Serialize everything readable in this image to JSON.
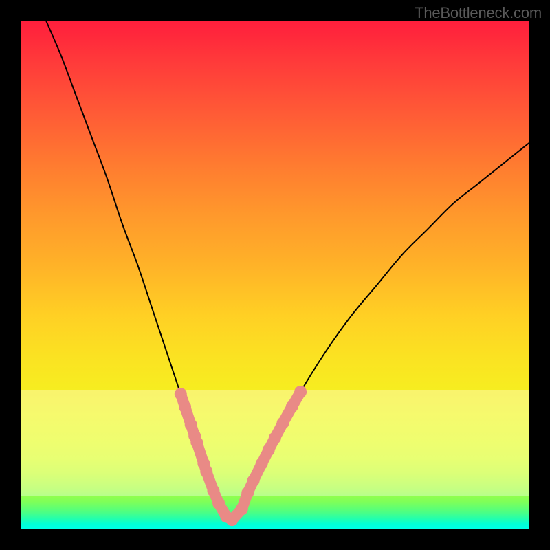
{
  "watermark": "TheBottleneck.com",
  "chart_data": {
    "type": "line",
    "title": "",
    "xlabel": "",
    "ylabel": "",
    "xlim": [
      0,
      1
    ],
    "ylim": [
      0,
      1
    ],
    "series": [
      {
        "name": "bottleneck-curve",
        "x": [
          0.05,
          0.08,
          0.11,
          0.14,
          0.17,
          0.2,
          0.23,
          0.26,
          0.29,
          0.31,
          0.33,
          0.35,
          0.37,
          0.39,
          0.41,
          0.43,
          0.45,
          0.5,
          0.55,
          0.6,
          0.65,
          0.7,
          0.75,
          0.8,
          0.85,
          0.9,
          0.95,
          1.0
        ],
        "y": [
          1.0,
          0.93,
          0.85,
          0.77,
          0.69,
          0.6,
          0.52,
          0.43,
          0.34,
          0.28,
          0.22,
          0.16,
          0.1,
          0.05,
          0.02,
          0.03,
          0.08,
          0.18,
          0.27,
          0.35,
          0.42,
          0.48,
          0.54,
          0.59,
          0.64,
          0.68,
          0.72,
          0.76
        ]
      }
    ],
    "threshold_band": {
      "y_top": 0.275,
      "y_bottom": 0.065
    },
    "bead_markers": {
      "left_branch": [
        0.265,
        0.24,
        0.205,
        0.185,
        0.17,
        0.13,
        0.115,
        0.075,
        0.05,
        0.025,
        0.01
      ],
      "right_branch": [
        0.01,
        0.04,
        0.07,
        0.095,
        0.13,
        0.155,
        0.18,
        0.21,
        0.24,
        0.27
      ]
    }
  }
}
